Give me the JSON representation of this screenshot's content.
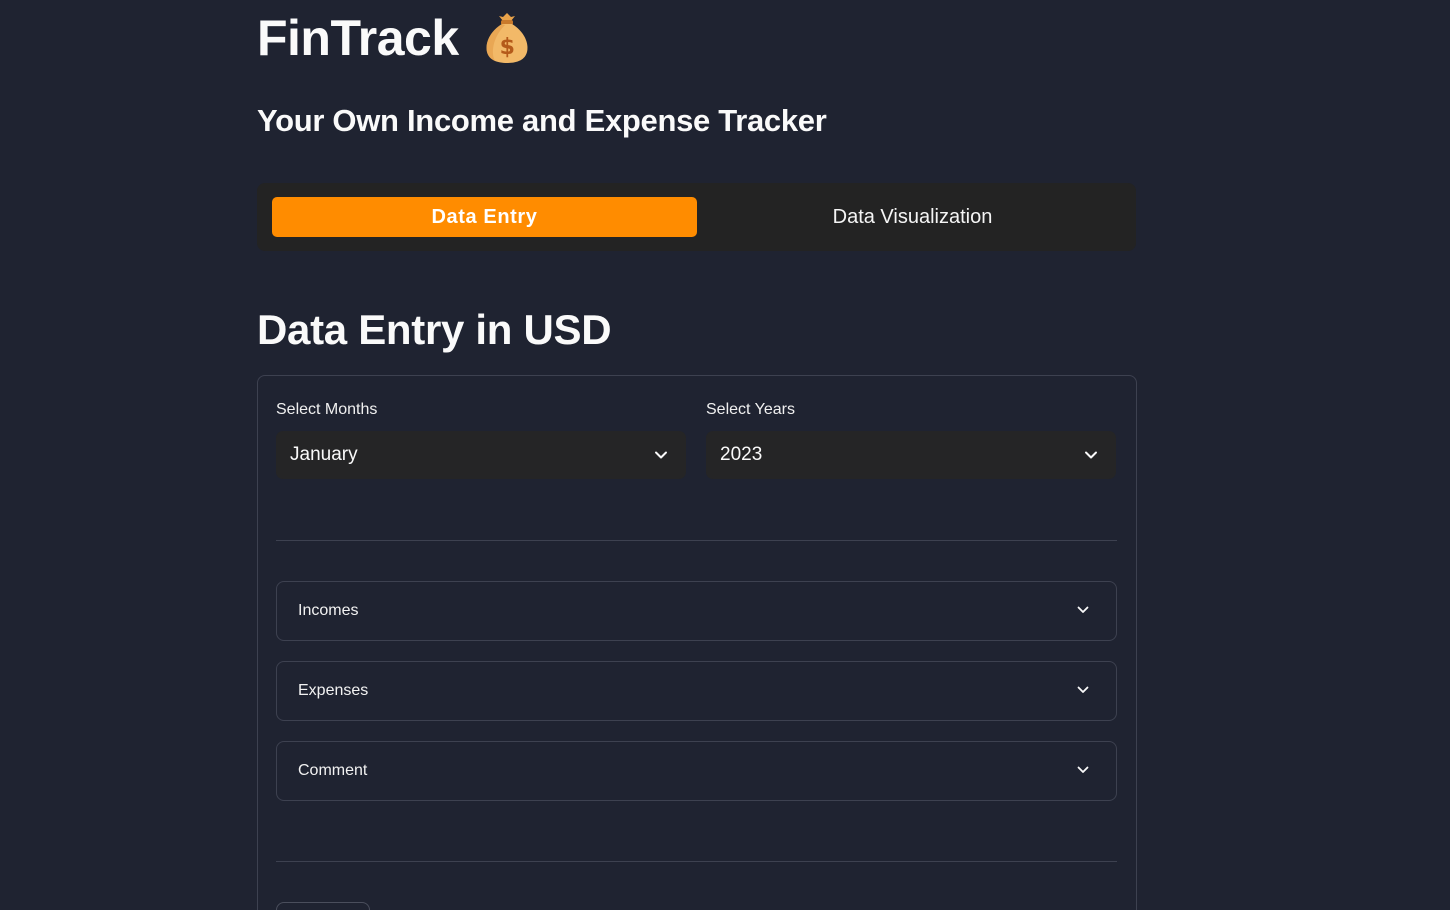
{
  "header": {
    "app_title": "FinTrack",
    "app_icon": "money-bag-icon",
    "subtitle": "Your Own Income and Expense Tracker"
  },
  "tabs": [
    {
      "label": "Data Entry",
      "active": true
    },
    {
      "label": "Data Visualization",
      "active": false
    }
  ],
  "main": {
    "section_title": "Data Entry in USD",
    "month_select": {
      "label": "Select Months",
      "value": "January"
    },
    "year_select": {
      "label": "Select Years",
      "value": "2023"
    },
    "expanders": [
      {
        "label": "Incomes"
      },
      {
        "label": "Expenses"
      },
      {
        "label": "Comment"
      }
    ]
  },
  "colors": {
    "background": "#1f2331",
    "accent": "#ff8c00",
    "tabbar": "#232323",
    "select_bg": "#252526",
    "border": "#3d4150"
  }
}
